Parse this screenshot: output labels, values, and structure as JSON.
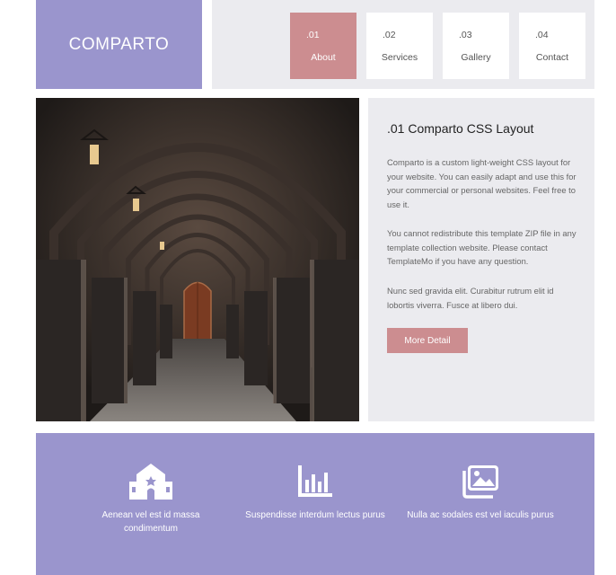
{
  "site": {
    "logo": "COMPARTO"
  },
  "nav": {
    "items": [
      {
        "num": ".01",
        "label": "About",
        "active": true
      },
      {
        "num": ".02",
        "label": "Services",
        "active": false
      },
      {
        "num": ".03",
        "label": "Gallery",
        "active": false
      },
      {
        "num": ".04",
        "label": "Contact",
        "active": false
      }
    ]
  },
  "hero": {
    "image_icon": "corridor-arches-photo",
    "title": ".01 Comparto CSS Layout",
    "paragraphs": [
      "Comparto is a custom light-weight CSS layout for your website. You can easily adapt and use this for your commercial or personal websites. Feel free to use it.",
      "You cannot redistribute this template ZIP file in any template collection website. Please contact TemplateMo if you have any question.",
      "Nunc sed gravida elit. Curabitur rutrum elit id lobortis viverra. Fusce at libero dui."
    ],
    "button_label": "More Detail"
  },
  "features": [
    {
      "icon": "building-icon",
      "text": "Aenean vel est id massa condimentum"
    },
    {
      "icon": "bar-chart-icon",
      "text": "Suspendisse interdum lectus purus"
    },
    {
      "icon": "images-icon",
      "text": "Nulla ac sodales est vel iaculis purus"
    }
  ],
  "colors": {
    "purple": "#9a95cd",
    "rose": "#cc8d90",
    "light_gray": "#ebebef"
  }
}
